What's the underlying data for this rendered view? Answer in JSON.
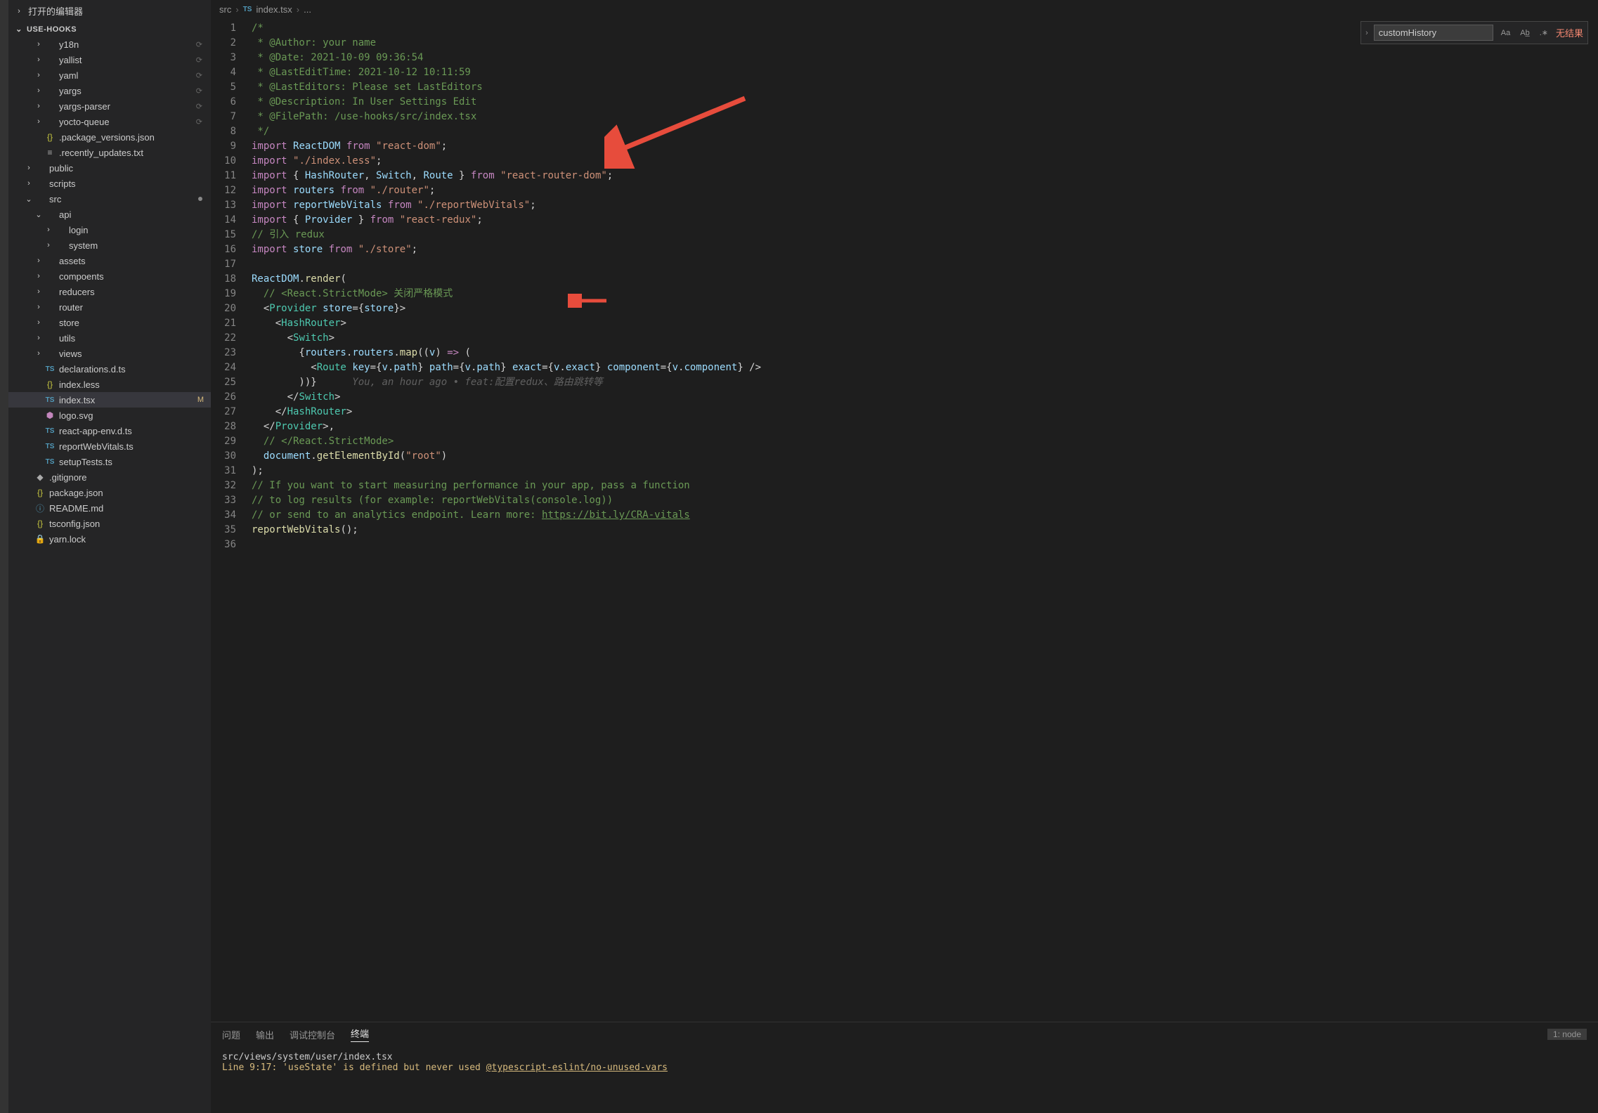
{
  "sidebar": {
    "open_editors_label": "打开的编辑器",
    "project_name": "USE-HOOKS",
    "items": [
      {
        "ind": 28,
        "chev": "›",
        "icon": "",
        "name": "y18n",
        "type": "folder",
        "nosync": true
      },
      {
        "ind": 28,
        "chev": "›",
        "icon": "",
        "name": "yallist",
        "type": "folder",
        "nosync": true
      },
      {
        "ind": 28,
        "chev": "›",
        "icon": "",
        "name": "yaml",
        "type": "folder",
        "nosync": true
      },
      {
        "ind": 28,
        "chev": "›",
        "icon": "",
        "name": "yargs",
        "type": "folder",
        "nosync": true
      },
      {
        "ind": 28,
        "chev": "›",
        "icon": "",
        "name": "yargs-parser",
        "type": "folder",
        "nosync": true
      },
      {
        "ind": 28,
        "chev": "›",
        "icon": "",
        "name": "yocto-queue",
        "type": "folder",
        "nosync": true
      },
      {
        "ind": 28,
        "chev": "",
        "icon": "{}",
        "name": ".package_versions.json",
        "type": "json"
      },
      {
        "ind": 28,
        "chev": "",
        "icon": "≡",
        "name": ".recently_updates.txt",
        "type": "file"
      },
      {
        "ind": 14,
        "chev": "›",
        "icon": "",
        "name": "public",
        "type": "folder"
      },
      {
        "ind": 14,
        "chev": "›",
        "icon": "",
        "name": "scripts",
        "type": "folder"
      },
      {
        "ind": 14,
        "chev": "⌄",
        "icon": "",
        "name": "src",
        "type": "folder",
        "dot": true
      },
      {
        "ind": 28,
        "chev": "⌄",
        "icon": "",
        "name": "api",
        "type": "folder"
      },
      {
        "ind": 42,
        "chev": "›",
        "icon": "",
        "name": "login",
        "type": "folder"
      },
      {
        "ind": 42,
        "chev": "›",
        "icon": "",
        "name": "system",
        "type": "folder"
      },
      {
        "ind": 28,
        "chev": "›",
        "icon": "",
        "name": "assets",
        "type": "folder"
      },
      {
        "ind": 28,
        "chev": "›",
        "icon": "",
        "name": "compoents",
        "type": "folder"
      },
      {
        "ind": 28,
        "chev": "›",
        "icon": "",
        "name": "reducers",
        "type": "folder"
      },
      {
        "ind": 28,
        "chev": "›",
        "icon": "",
        "name": "router",
        "type": "folder"
      },
      {
        "ind": 28,
        "chev": "›",
        "icon": "",
        "name": "store",
        "type": "folder"
      },
      {
        "ind": 28,
        "chev": "›",
        "icon": "",
        "name": "utils",
        "type": "folder"
      },
      {
        "ind": 28,
        "chev": "›",
        "icon": "",
        "name": "views",
        "type": "folder"
      },
      {
        "ind": 28,
        "chev": "",
        "icon": "TS",
        "name": "declarations.d.ts",
        "type": "ts"
      },
      {
        "ind": 28,
        "chev": "",
        "icon": "{}",
        "name": "index.less",
        "type": "json"
      },
      {
        "ind": 28,
        "chev": "",
        "icon": "TS",
        "name": "index.tsx",
        "type": "ts",
        "active": true,
        "mod": "M"
      },
      {
        "ind": 28,
        "chev": "",
        "icon": "⬢",
        "name": "logo.svg",
        "type": "svg"
      },
      {
        "ind": 28,
        "chev": "",
        "icon": "TS",
        "name": "react-app-env.d.ts",
        "type": "ts"
      },
      {
        "ind": 28,
        "chev": "",
        "icon": "TS",
        "name": "reportWebVitals.ts",
        "type": "ts"
      },
      {
        "ind": 28,
        "chev": "",
        "icon": "TS",
        "name": "setupTests.ts",
        "type": "ts"
      },
      {
        "ind": 14,
        "chev": "",
        "icon": "◆",
        "name": ".gitignore",
        "type": "file"
      },
      {
        "ind": 14,
        "chev": "",
        "icon": "{}",
        "name": "package.json",
        "type": "json"
      },
      {
        "ind": 14,
        "chev": "",
        "icon": "ⓘ",
        "name": "README.md",
        "type": "info"
      },
      {
        "ind": 14,
        "chev": "",
        "icon": "{}",
        "name": "tsconfig.json",
        "type": "json"
      },
      {
        "ind": 14,
        "chev": "",
        "icon": "🔒",
        "name": "yarn.lock",
        "type": "file"
      }
    ]
  },
  "breadcrumbs": [
    "src",
    "index.tsx",
    "..."
  ],
  "breadcrumb_icon": "TS",
  "find": {
    "value": "customHistory",
    "opts": [
      "Aa",
      "Ab̲",
      ".∗"
    ],
    "no_results": "无结果"
  },
  "code_lines": [
    {
      "n": 1,
      "html": "/*",
      "cls": "c-com"
    },
    {
      "n": 2,
      "html": " * @Author: your name",
      "cls": "c-com"
    },
    {
      "n": 3,
      "html": " * @Date: 2021-10-09 09:36:54",
      "cls": "c-com"
    },
    {
      "n": 4,
      "html": " * @LastEditTime: 2021-10-12 10:11:59",
      "cls": "c-com"
    },
    {
      "n": 5,
      "html": " * @LastEditors: Please set LastEditors",
      "cls": "c-com"
    },
    {
      "n": 6,
      "html": " * @Description: In User Settings Edit",
      "cls": "c-com"
    },
    {
      "n": 7,
      "html": " * @FilePath: /use-hooks/src/index.tsx",
      "cls": "c-com"
    },
    {
      "n": 8,
      "html": " */",
      "cls": "c-com"
    },
    {
      "n": 9,
      "segs": [
        [
          "c-kw",
          "import "
        ],
        [
          "c-var",
          "ReactDOM"
        ],
        [
          "",
          " "
        ],
        [
          "c-kw",
          "from"
        ],
        [
          "",
          " "
        ],
        [
          "c-str",
          "\"react-dom\""
        ],
        [
          "",
          ";"
        ]
      ]
    },
    {
      "n": 10,
      "segs": [
        [
          "c-kw",
          "import "
        ],
        [
          "c-str",
          "\"./index.less\""
        ],
        [
          "",
          ";"
        ]
      ]
    },
    {
      "n": 11,
      "segs": [
        [
          "c-kw",
          "import "
        ],
        [
          "",
          "{ "
        ],
        [
          "c-var",
          "HashRouter"
        ],
        [
          "",
          ", "
        ],
        [
          "c-var",
          "Switch"
        ],
        [
          "",
          ", "
        ],
        [
          "c-var",
          "Route"
        ],
        [
          "",
          " } "
        ],
        [
          "c-kw",
          "from"
        ],
        [
          "",
          " "
        ],
        [
          "c-str",
          "\"react-router-dom\""
        ],
        [
          "",
          ";"
        ]
      ]
    },
    {
      "n": 12,
      "segs": [
        [
          "c-kw",
          "import "
        ],
        [
          "c-var",
          "routers"
        ],
        [
          "",
          " "
        ],
        [
          "c-kw",
          "from"
        ],
        [
          "",
          " "
        ],
        [
          "c-str",
          "\"./router\""
        ],
        [
          "",
          ";"
        ]
      ]
    },
    {
      "n": 13,
      "segs": [
        [
          "c-kw",
          "import "
        ],
        [
          "c-var",
          "reportWebVitals"
        ],
        [
          "",
          " "
        ],
        [
          "c-kw",
          "from"
        ],
        [
          "",
          " "
        ],
        [
          "c-str",
          "\"./reportWebVitals\""
        ],
        [
          "",
          ";"
        ]
      ]
    },
    {
      "n": 14,
      "segs": [
        [
          "c-kw",
          "import "
        ],
        [
          "",
          "{ "
        ],
        [
          "c-var",
          "Provider"
        ],
        [
          "",
          " } "
        ],
        [
          "c-kw",
          "from"
        ],
        [
          "",
          " "
        ],
        [
          "c-str",
          "\"react-redux\""
        ],
        [
          "",
          ";"
        ]
      ]
    },
    {
      "n": 15,
      "html": "// 引入 redux",
      "cls": "c-com"
    },
    {
      "n": 16,
      "segs": [
        [
          "c-kw",
          "import "
        ],
        [
          "c-var",
          "store"
        ],
        [
          "",
          " "
        ],
        [
          "c-kw",
          "from"
        ],
        [
          "",
          " "
        ],
        [
          "c-str",
          "\"./store\""
        ],
        [
          "",
          ";"
        ]
      ]
    },
    {
      "n": 17,
      "html": " "
    },
    {
      "n": 18,
      "segs": [
        [
          "c-var",
          "ReactDOM"
        ],
        [
          "",
          "."
        ],
        [
          "c-fn",
          "render"
        ],
        [
          "",
          "("
        ]
      ]
    },
    {
      "n": 19,
      "html": "  // <React.StrictMode> 关闭严格模式",
      "cls": "c-com"
    },
    {
      "n": 20,
      "segs": [
        [
          "",
          "  <"
        ],
        [
          "c-tag",
          "Provider"
        ],
        [
          "",
          " "
        ],
        [
          "c-var",
          "store"
        ],
        [
          "",
          "="
        ],
        [
          "",
          "{"
        ],
        [
          "c-var",
          "store"
        ],
        [
          "",
          "}>"
        ]
      ]
    },
    {
      "n": 21,
      "segs": [
        [
          "",
          "    <"
        ],
        [
          "c-tag",
          "HashRouter"
        ],
        [
          "",
          ">"
        ]
      ]
    },
    {
      "n": 22,
      "segs": [
        [
          "",
          "      <"
        ],
        [
          "c-tag",
          "Switch"
        ],
        [
          "",
          ">"
        ]
      ]
    },
    {
      "n": 23,
      "segs": [
        [
          "",
          "        {"
        ],
        [
          "c-var",
          "routers"
        ],
        [
          "",
          "."
        ],
        [
          "c-var",
          "routers"
        ],
        [
          "",
          "."
        ],
        [
          "c-fn",
          "map"
        ],
        [
          "",
          "(("
        ],
        [
          "c-var",
          "v"
        ],
        [
          "",
          ") "
        ],
        [
          "c-kw",
          "=>"
        ],
        [
          "",
          " ("
        ]
      ]
    },
    {
      "n": 24,
      "segs": [
        [
          "",
          "          <"
        ],
        [
          "c-tag",
          "Route"
        ],
        [
          "",
          " "
        ],
        [
          "c-var",
          "key"
        ],
        [
          "",
          "={"
        ],
        [
          "c-var",
          "v"
        ],
        [
          "",
          "."
        ],
        [
          "c-var",
          "path"
        ],
        [
          "",
          "} "
        ],
        [
          "c-var",
          "path"
        ],
        [
          "",
          "={"
        ],
        [
          "c-var",
          "v"
        ],
        [
          "",
          "."
        ],
        [
          "c-var",
          "path"
        ],
        [
          "",
          "} "
        ],
        [
          "c-var",
          "exact"
        ],
        [
          "",
          "={"
        ],
        [
          "c-var",
          "v"
        ],
        [
          "",
          "."
        ],
        [
          "c-var",
          "exact"
        ],
        [
          "",
          "} "
        ],
        [
          "c-var",
          "component"
        ],
        [
          "",
          "={"
        ],
        [
          "c-var",
          "v"
        ],
        [
          "",
          "."
        ],
        [
          "c-var",
          "component"
        ],
        [
          "",
          "} />"
        ]
      ]
    },
    {
      "n": 25,
      "segs": [
        [
          "",
          "        ))}      "
        ],
        [
          "c-blame",
          "You, an hour ago • feat:配置redux、路由跳转等"
        ]
      ]
    },
    {
      "n": 26,
      "segs": [
        [
          "",
          "      </"
        ],
        [
          "c-tag",
          "Switch"
        ],
        [
          "",
          ">"
        ]
      ]
    },
    {
      "n": 27,
      "segs": [
        [
          "",
          "    </"
        ],
        [
          "c-tag",
          "HashRouter"
        ],
        [
          "",
          ">"
        ]
      ]
    },
    {
      "n": 28,
      "segs": [
        [
          "",
          "  </"
        ],
        [
          "c-tag",
          "Provider"
        ],
        [
          "",
          ">,"
        ]
      ]
    },
    {
      "n": 29,
      "html": "  // </React.StrictMode>",
      "cls": "c-com"
    },
    {
      "n": 30,
      "segs": [
        [
          "",
          "  "
        ],
        [
          "c-var",
          "document"
        ],
        [
          "",
          "."
        ],
        [
          "c-fn",
          "getElementById"
        ],
        [
          "",
          "("
        ],
        [
          "c-str",
          "\"root\""
        ],
        [
          "",
          ")"
        ]
      ]
    },
    {
      "n": 31,
      "html": ");"
    },
    {
      "n": 32,
      "html": "// If you want to start measuring performance in your app, pass a function",
      "cls": "c-com"
    },
    {
      "n": 33,
      "html": "// to log results (for example: reportWebVitals(console.log))",
      "cls": "c-com"
    },
    {
      "n": 34,
      "segs": [
        [
          "c-com",
          "// or send to an analytics endpoint. Learn more: "
        ],
        [
          "c-link",
          "https://bit.ly/CRA-vitals"
        ]
      ]
    },
    {
      "n": 35,
      "segs": [
        [
          "c-fn",
          "reportWebVitals"
        ],
        [
          "",
          "();"
        ]
      ]
    },
    {
      "n": 36,
      "html": " "
    }
  ],
  "terminal": {
    "tabs": [
      "问题",
      "输出",
      "调试控制台",
      "终端"
    ],
    "active_tab": 3,
    "selector": "1: node",
    "line1": "src/views/system/user/index.tsx",
    "line2_a": "  Line 9:17:  'useState' is defined but never used  ",
    "line2_link": "@typescript-eslint/no-unused-vars"
  }
}
